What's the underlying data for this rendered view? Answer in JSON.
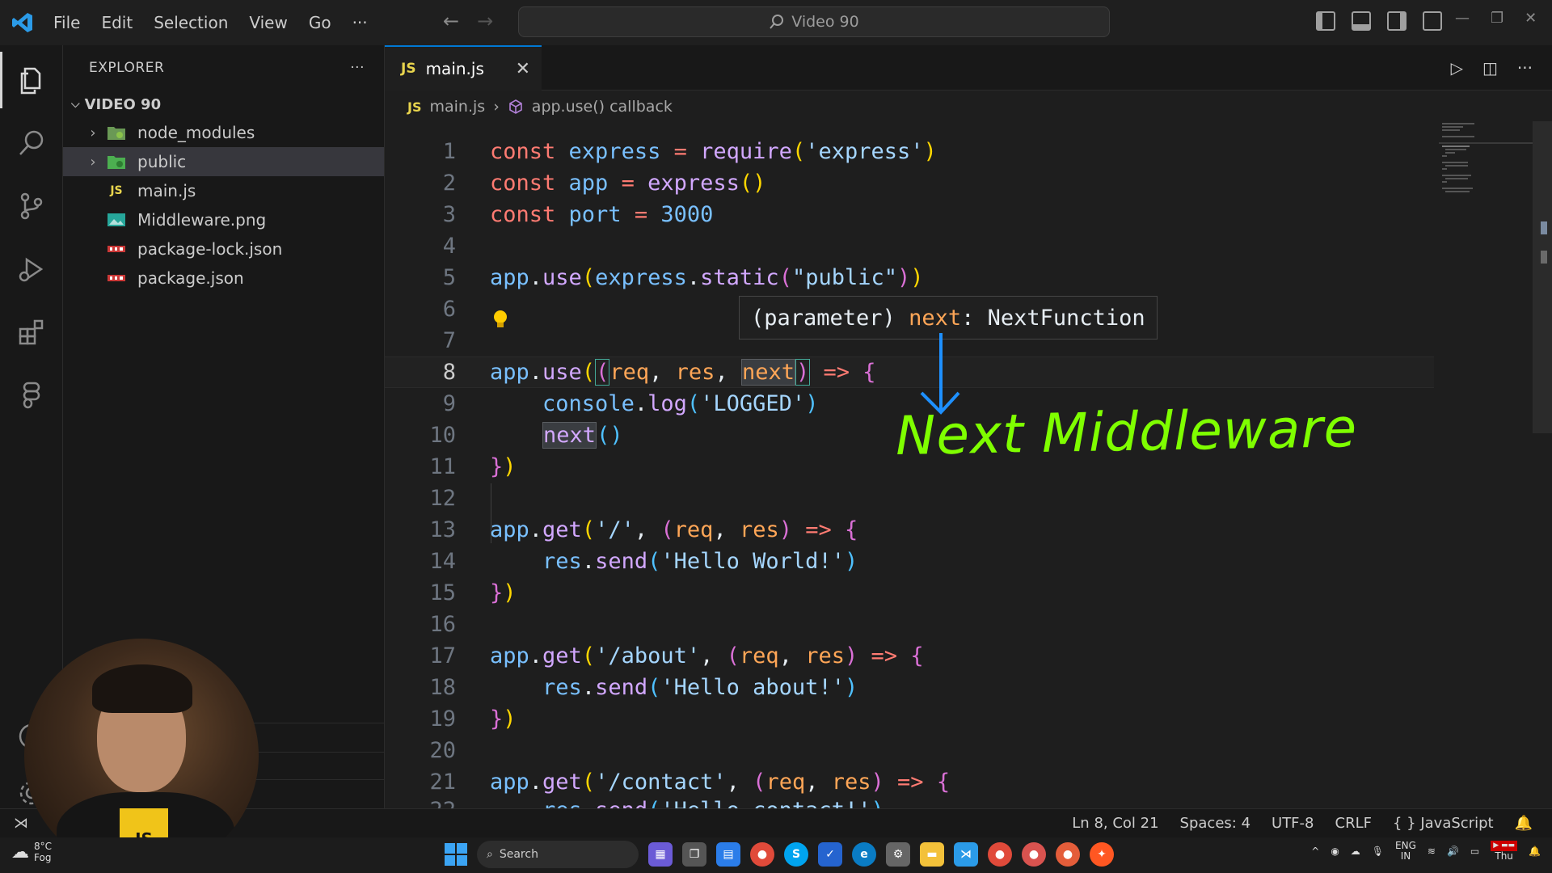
{
  "window": {
    "search_text": "Video 90"
  },
  "menu": [
    "File",
    "Edit",
    "Selection",
    "View",
    "Go",
    "···"
  ],
  "explorer": {
    "title": "EXPLORER",
    "more": "···",
    "folder": "VIDEO 90",
    "files": [
      {
        "name": "node_modules",
        "type": "folder",
        "expanded": false
      },
      {
        "name": "public",
        "type": "folder",
        "expanded": false,
        "selected": true
      },
      {
        "name": "main.js",
        "type": "js"
      },
      {
        "name": "Middleware.png",
        "type": "image"
      },
      {
        "name": "package-lock.json",
        "type": "json"
      },
      {
        "name": "package.json",
        "type": "json"
      }
    ]
  },
  "tab": {
    "icon": "JS",
    "label": "main.js",
    "close": "✕"
  },
  "breadcrumb": {
    "icon": "JS",
    "file": "main.js",
    "symbol": "app.use() callback"
  },
  "code_lines": [
    "const express = require('express')",
    "const app = express()",
    "const port = 3000",
    "",
    "app.use(express.static(\"public\"))",
    "",
    "",
    "app.use((req, res, next) => {",
    "    console.log('LOGGED')",
    "    next()",
    "})",
    "",
    "app.get('/', (req, res) => {",
    "    res.send('Hello World!')",
    "})",
    "",
    "app.get('/about', (req, res) => {",
    "    res.send('Hello about!')",
    "})",
    "",
    "app.get('/contact', (req, res) => {",
    "    res.send('Hello contact!')"
  ],
  "current_line": 8,
  "hover": {
    "prefix": "(parameter) ",
    "name": "next",
    "sep": ": ",
    "type": "NextFunction"
  },
  "annotation": "Next Middleware",
  "status": {
    "position": "Ln 8, Col 21",
    "spaces": "Spaces: 4",
    "encoding": "UTF-8",
    "eol": "CRLF",
    "language": "JavaScript"
  },
  "taskbar": {
    "weather_temp": "8°C",
    "weather_desc": "Fog",
    "search": "Search",
    "lang_top": "ENG",
    "lang_bottom": "IN",
    "day": "Thu"
  },
  "colors": {
    "accent": "#0078d4",
    "annotation": "#7fff00",
    "js_yellow": "#e8d44d"
  }
}
